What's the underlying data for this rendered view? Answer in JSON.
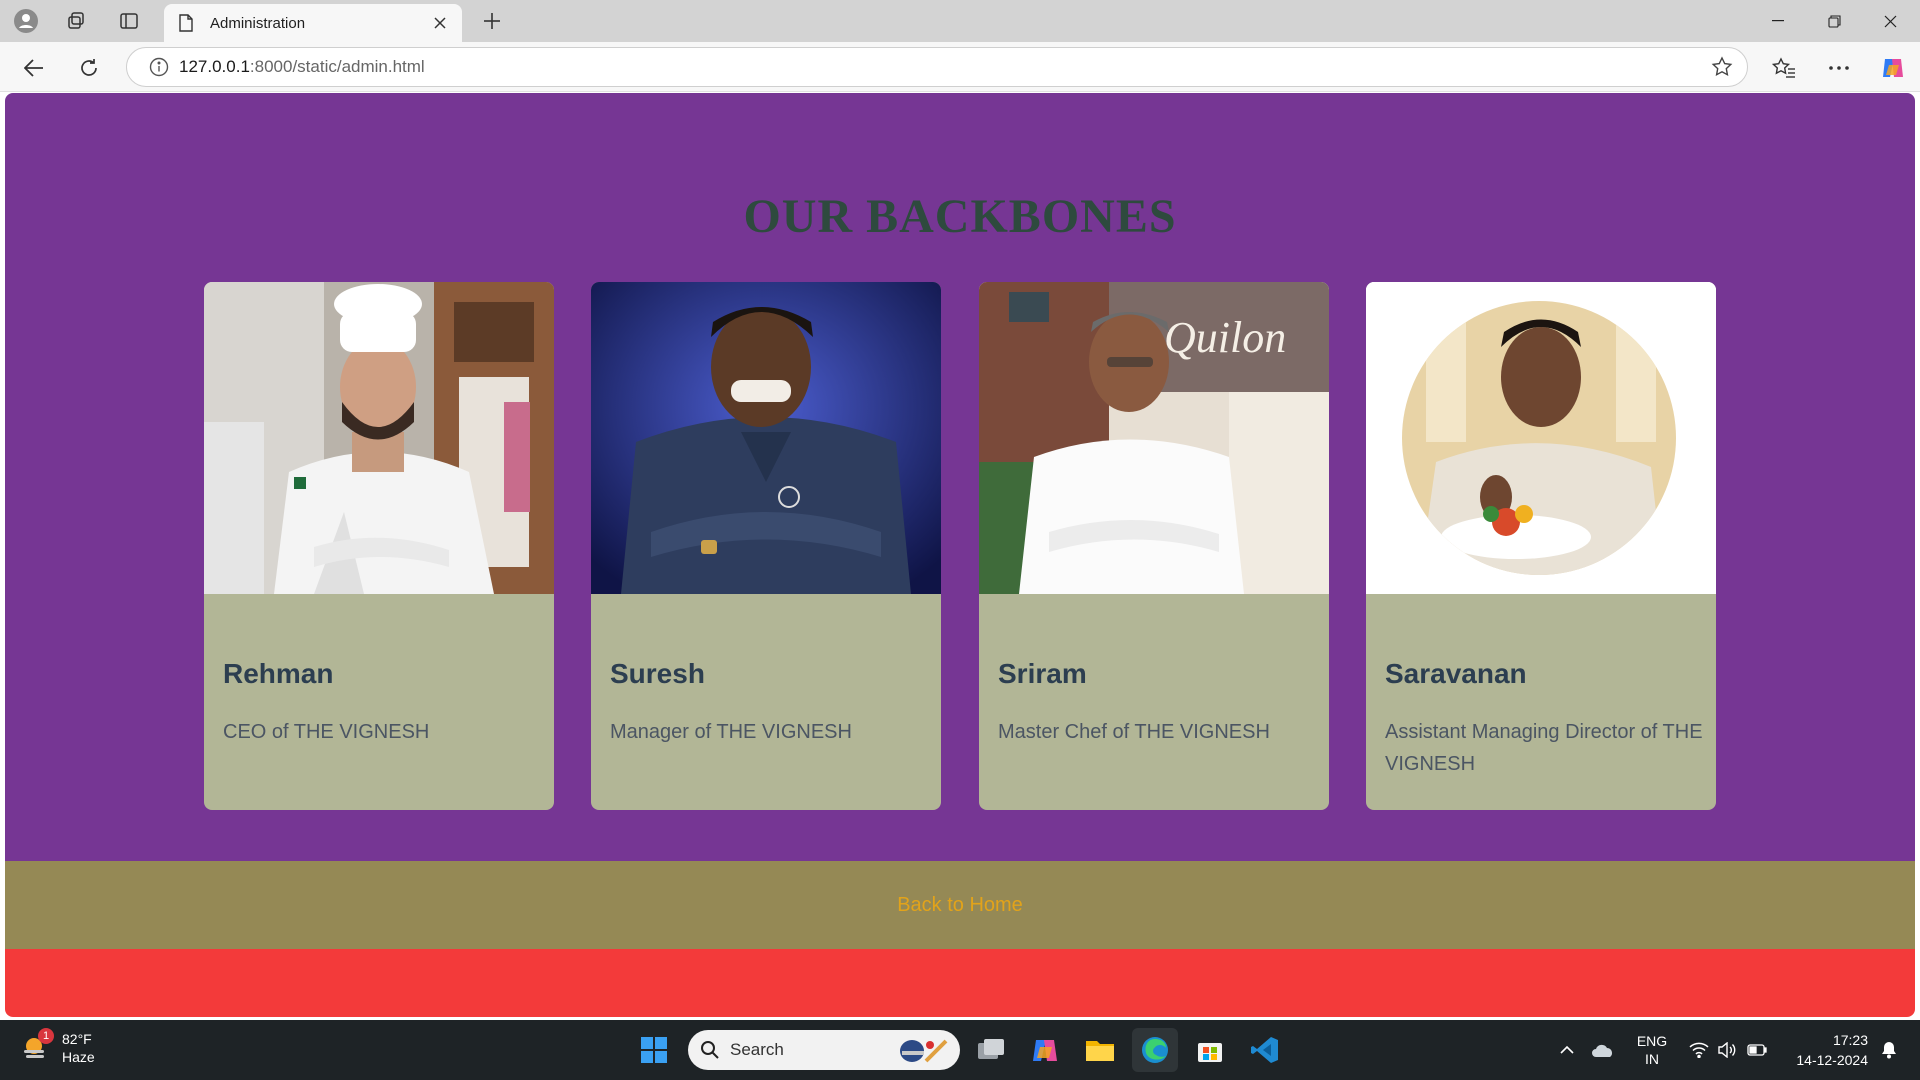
{
  "browser": {
    "tab_title": "Administration",
    "url_host": "127.0.0.1",
    "url_path": ":8000/static/admin.html"
  },
  "page": {
    "heading": "OUR BACKBONES",
    "cards": [
      {
        "name": "Rehman",
        "role": "CEO of THE VIGNESH"
      },
      {
        "name": "Suresh",
        "role": "Manager of THE VIGNESH"
      },
      {
        "name": "Sriram",
        "role": "Master Chef of THE VIGNESH"
      },
      {
        "name": "Saravanan",
        "role": "Assistant Managing Director of THE VIGNESH"
      }
    ],
    "back_link": "Back to Home",
    "colors": {
      "hero_bg": "#763694",
      "card_bg": "#b2b696",
      "footer_bg": "#958955",
      "link": "#e2a31a",
      "red_band": "#f33a3a"
    }
  },
  "taskbar": {
    "weather_temp": "82°F",
    "weather_desc": "Haze",
    "weather_badge": "1",
    "search_label": "Search",
    "lang_top": "ENG",
    "lang_bottom": "IN",
    "time": "17:23",
    "date": "14-12-2024"
  }
}
